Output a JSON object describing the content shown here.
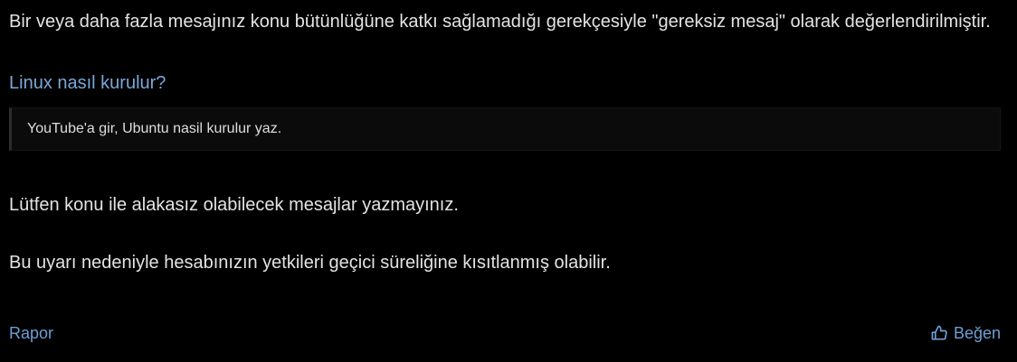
{
  "post": {
    "warning_text": "Bir veya daha fazla mesajınız konu bütünlüğüne katkı sağlamadığı gerekçesiyle \"gereksiz mesaj\" olarak değerlendirilmiştir.",
    "thread_title": "Linux nasıl kurulur?",
    "quote_text": "YouTube'a gir, Ubuntu nasil kurulur yaz.",
    "paragraph_1": "Lütfen konu ile alakasız olabilecek mesajlar yazmayınız.",
    "paragraph_2": "Bu uyarı nedeniyle hesabınızın yetkileri geçici süreliğine kısıtlanmış olabilir."
  },
  "footer": {
    "report_label": "Rapor",
    "like_label": "Beğen",
    "like_icon": "thumbs-up-icon"
  },
  "colors": {
    "background": "#000000",
    "text": "#e3e3e3",
    "link": "#7aa7d8",
    "quote_background": "#0b0b0b",
    "quote_border": "#2c2c2c"
  }
}
